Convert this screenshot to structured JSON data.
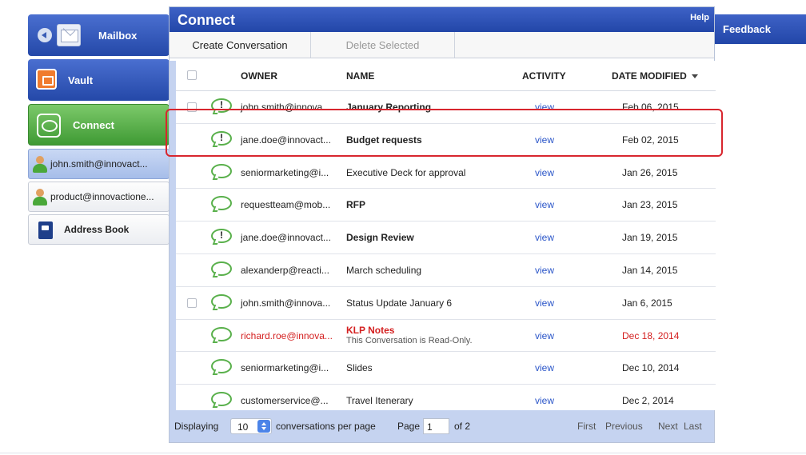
{
  "sidebar": {
    "mailbox_label": "Mailbox",
    "vault_label": "Vault",
    "connect_label": "Connect",
    "accounts": [
      {
        "label": "john.smith@innovact..."
      },
      {
        "label": "product@innovactione..."
      }
    ],
    "address_book_label": "Address Book"
  },
  "panel": {
    "title": "Connect",
    "help_label": "Help",
    "toolbar": {
      "create_label": "Create Conversation",
      "delete_label": "Delete Selected"
    },
    "columns": {
      "owner": "OWNER",
      "name": "NAME",
      "activity": "ACTIVITY",
      "date": "DATE MODIFIED"
    },
    "rows": [
      {
        "owner": "john.smith@innova...",
        "name": "January Reporting",
        "activity": "view",
        "date": "Feb 06, 2015"
      },
      {
        "owner": "jane.doe@innovact...",
        "name": "Budget requests",
        "activity": "view",
        "date": "Feb 02, 2015"
      },
      {
        "owner": "seniormarketing@i...",
        "name": "Executive Deck for approval",
        "activity": "view",
        "date": "Jan 26, 2015"
      },
      {
        "owner": "requestteam@mob...",
        "name": "RFP",
        "activity": "view",
        "date": "Jan 23, 2015"
      },
      {
        "owner": "jane.doe@innovact...",
        "name": "Design Review",
        "activity": "view",
        "date": "Jan 19, 2015"
      },
      {
        "owner": "alexanderp@reacti...",
        "name": "March scheduling",
        "activity": "view",
        "date": "Jan 14, 2015"
      },
      {
        "owner": "john.smith@innova...",
        "name": "Status Update January 6",
        "activity": "view",
        "date": "Jan 6, 2015"
      },
      {
        "owner": "richard.roe@innova...",
        "name": "KLP Notes",
        "subtitle": "This Conversation is Read-Only.",
        "activity": "view",
        "date": "Dec 18, 2014"
      },
      {
        "owner": "seniormarketing@i...",
        "name": "Slides",
        "activity": "view",
        "date": "Dec 10, 2014"
      },
      {
        "owner": "customerservice@...",
        "name": "Travel Itenerary",
        "activity": "view",
        "date": "Dec 2, 2014"
      }
    ],
    "footer": {
      "displaying": "Displaying",
      "per_page_value": "10",
      "per_page_suffix": "conversations per page",
      "page_label": "Page",
      "page_value": "1",
      "of_label": "of 2",
      "first": "First",
      "previous": "Previous",
      "next": "Next",
      "last": "Last"
    }
  },
  "feedback_label": "Feedback",
  "colors": {
    "brand_blue": "#2a4fb8",
    "connect_green": "#4faa40",
    "highlight_red": "#d8262e",
    "readonly_red": "#d42020",
    "link_blue": "#2a55c8"
  }
}
